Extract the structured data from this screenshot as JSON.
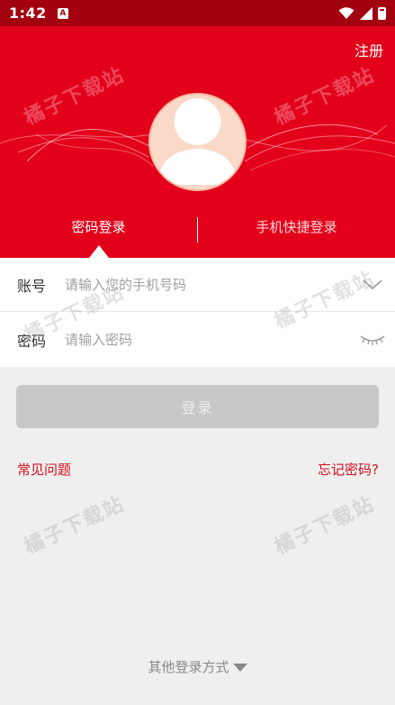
{
  "status_bar": {
    "time": "1:42",
    "app_icon_letter": "A",
    "icons": [
      "wifi-icon",
      "signal-icon",
      "battery-icon"
    ]
  },
  "header": {
    "register_label": "注册",
    "tabs": [
      {
        "label": "密码登录",
        "active": true
      },
      {
        "label": "手机快捷登录",
        "active": false
      }
    ]
  },
  "form": {
    "account_label": "账号",
    "account_placeholder": "请输入您的手机号码",
    "account_value": "",
    "password_label": "密码",
    "password_placeholder": "请输入密码",
    "password_value": ""
  },
  "actions": {
    "login_label": "登录",
    "faq_label": "常见问题",
    "forgot_label": "忘记密码?",
    "other_login_label": "其他登录方式"
  },
  "watermark": "橘子下载站",
  "colors": {
    "brand_red": "#e3001a",
    "status_bar": "#a3000f",
    "link_red": "#d4101e",
    "button_disabled": "#c8c8c8",
    "background": "#efefef"
  }
}
